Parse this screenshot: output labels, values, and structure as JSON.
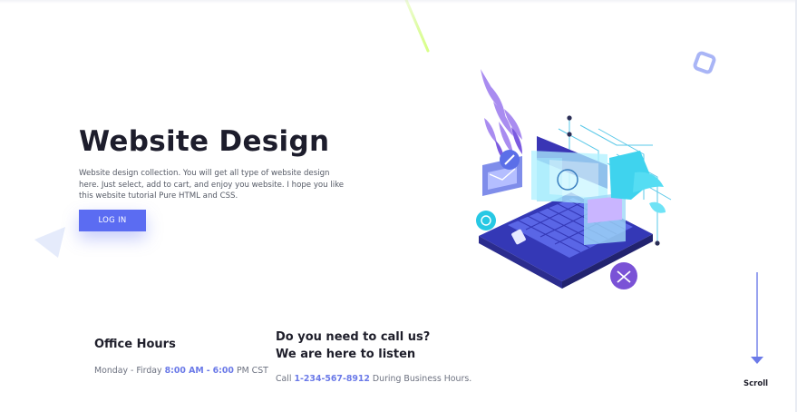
{
  "hero": {
    "title": "Website Design",
    "description": "Website design collection. You will get all type of website design here. Just select, add to cart, and enjoy you website. I hope you like this website tutorial Pure HTML and CSS.",
    "login_label": "LOG IN"
  },
  "office": {
    "title": "Office Hours",
    "days": "Monday - Firday",
    "open_time": "8:00 AM",
    "separator": "-",
    "close_hour": "6:00",
    "close_suffix": "PM CST"
  },
  "contact": {
    "title_line1": "Do you need to call us?",
    "title_line2": "We are here to listen",
    "prefix": "Call",
    "phone": "1-234-567-8912",
    "suffix": "During Business Hours."
  },
  "scroll": {
    "label": "Scroll"
  },
  "colors": {
    "accent": "#5b6cf2",
    "highlight": "#6b7ae8",
    "heading": "#1d1d2c",
    "body_text": "#6d7280"
  },
  "icons": [
    "diamond-deco-icon",
    "triangle-deco-icon",
    "scroll-arrow-icon",
    "laptop-illustration"
  ]
}
